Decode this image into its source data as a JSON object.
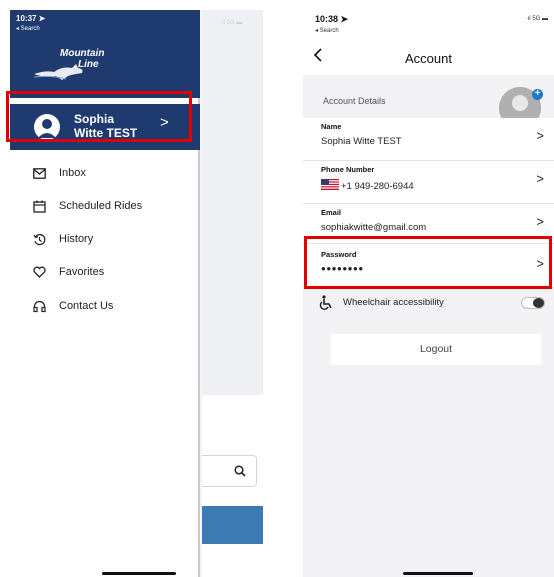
{
  "left_screen": {
    "status_time": "10:37 ➤",
    "status_back": "◂ Search",
    "logo": {
      "line1": "Mountain",
      "line2": "Line"
    },
    "user": {
      "name_line1": "Sophia",
      "name_line2": "Witte TEST",
      "chevron": ">"
    },
    "menu": [
      {
        "label": "Inbox",
        "icon": "mail-icon"
      },
      {
        "label": "Scheduled Rides",
        "icon": "calendar-icon"
      },
      {
        "label": "History",
        "icon": "history-icon"
      },
      {
        "label": "Favorites",
        "icon": "heart-icon"
      },
      {
        "label": "Contact Us",
        "icon": "headset-icon"
      }
    ],
    "colors": {
      "header_bg": "#1f3a6e",
      "button_blue": "#3b7ab4",
      "highlight": "#e00000"
    }
  },
  "right_screen": {
    "status_time": "10:38 ➤",
    "status_back": "◂ Search",
    "status_signal": "5G",
    "title": "Account",
    "section_label": "Account Details",
    "fields": [
      {
        "label": "Name",
        "value": "Sophia Witte TEST"
      },
      {
        "label": "Phone Number",
        "value": "+1 949-280-6944"
      },
      {
        "label": "Email",
        "value": "sophiakwitte@gmail.com"
      },
      {
        "label": "Password",
        "value": "●●●●●●●●"
      }
    ],
    "wheelchair_label": "Wheelchair accessibility",
    "logout_label": "Logout"
  }
}
